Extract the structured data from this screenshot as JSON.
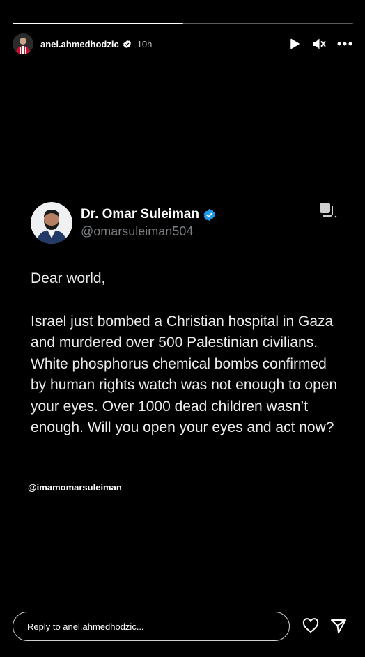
{
  "story": {
    "progress": 0.5,
    "username": "anel.ahmedhodzic",
    "time": "10h",
    "avatar_icon": "profile-avatar-red-striped"
  },
  "tweet": {
    "display_name": "Dr. Omar Suleiman",
    "handle": "@omarsuleiman504",
    "verified_color": "#1d9bf0",
    "greeting": "Dear world,",
    "body": "Israel just bombed a Christian hospital in Gaza and murdered over 500 Palestinian civilians. White phosphorus chemical bombs confirmed by human rights watch was not enough to open your eyes. Over 1000 dead children wasn’t enough. Will you open your eyes and act now?"
  },
  "credit": "@imamomarsuleiman",
  "reply": {
    "placeholder": "Reply to anel.ahmedhodzic..."
  }
}
